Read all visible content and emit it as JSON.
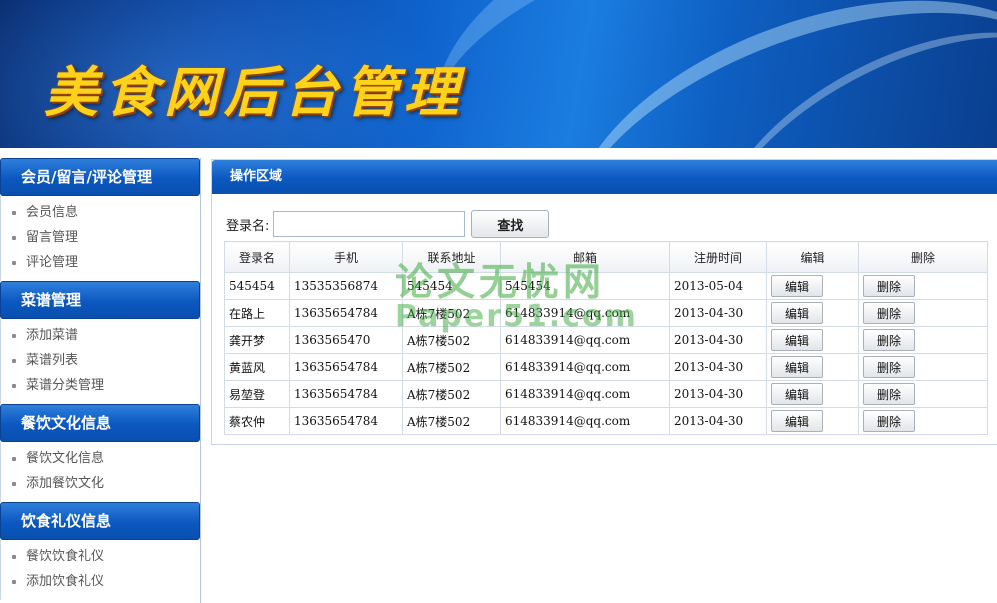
{
  "banner": {
    "title": "美食网后台管理"
  },
  "sidebar": {
    "groups": [
      {
        "title": "会员/留言/评论管理",
        "items": [
          "会员信息",
          "留言管理",
          "评论管理"
        ]
      },
      {
        "title": "菜谱管理",
        "items": [
          "添加菜谱",
          "菜谱列表",
          "菜谱分类管理"
        ]
      },
      {
        "title": "餐饮文化信息",
        "items": [
          "餐饮文化信息",
          "添加餐饮文化"
        ]
      },
      {
        "title": "饮食礼仪信息",
        "items": [
          "餐饮饮食礼仪",
          "添加饮食礼仪"
        ]
      }
    ]
  },
  "main": {
    "header": "操作区域",
    "search": {
      "label": "登录名:",
      "value": "",
      "button": "查找"
    },
    "table": {
      "columns": [
        "登录名",
        "手机",
        "联系地址",
        "邮箱",
        "注册时间",
        "编辑",
        "删除"
      ],
      "edit_label": "编辑",
      "delete_label": "删除",
      "rows": [
        [
          "545454",
          "13535356874",
          "545454",
          "545454",
          "2013-05-04"
        ],
        [
          "在路上",
          "13635654784",
          "A栋7楼502",
          "614833914@qq.com",
          "2013-04-30"
        ],
        [
          "龚开梦",
          "1363565470",
          "A栋7楼502",
          "614833914@qq.com",
          "2013-04-30"
        ],
        [
          "黄蓝风",
          "13635654784",
          "A栋7楼502",
          "614833914@qq.com",
          "2013-04-30"
        ],
        [
          "易堃登",
          "13635654784",
          "A栋7楼502",
          "614833914@qq.com",
          "2013-04-30"
        ],
        [
          "蔡农仲",
          "13635654784",
          "A栋7楼502",
          "614833914@qq.com",
          "2013-04-30"
        ]
      ]
    }
  },
  "watermark": {
    "line1": "论文无忧网",
    "line2": "Paper51.com"
  }
}
